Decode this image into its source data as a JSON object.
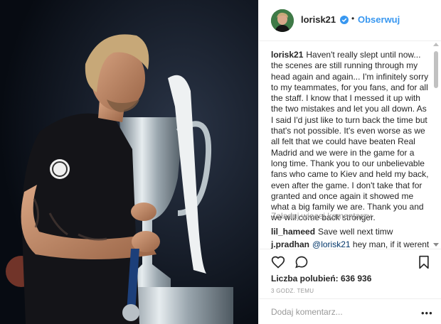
{
  "post": {
    "username": "lorisk21",
    "dot": "•",
    "follow_label": "Obserwuj",
    "caption": {
      "author": "lorisk21",
      "text": "Haven't really slept until now... the scenes are still running through my head again and again... I'm infinitely sorry to my teammates, for you fans, and for all the staff. I know that I messed it up with the two mistakes and let you all down. As I said I'd just like to turn back the time but that's not possible. It's even worse as we all felt that we could have beaten Real Madrid and we were in the game for a long time. Thank you to our unbelievable fans who came to Kiev and held my back, even after the game. I don't take that for granted and once again it showed me what a big family we are. Thank you and we will come back stronger."
    },
    "load_more_label": "Załaduj więcej komentarzy",
    "comments": [
      {
        "author": "lil_hameed",
        "mention": "",
        "text": "Save well next timw"
      },
      {
        "author": "j.pradhan",
        "mention": "@lorisk21",
        "text": "hey man, if it werent"
      }
    ],
    "likes_label": "Liczba polubień: 636 936",
    "timestamp": "3 GODZ. TEMU",
    "add_comment_placeholder": "Dodaj komentarz...",
    "more_label": "•••",
    "icons": {
      "like": "heart-icon",
      "comment": "comment-icon",
      "save": "bookmark-icon",
      "verified": "verified-badge-icon"
    },
    "colors": {
      "follow": "#3897f0",
      "verified": "#3897f0",
      "muted": "#999999",
      "text": "#262626"
    }
  }
}
